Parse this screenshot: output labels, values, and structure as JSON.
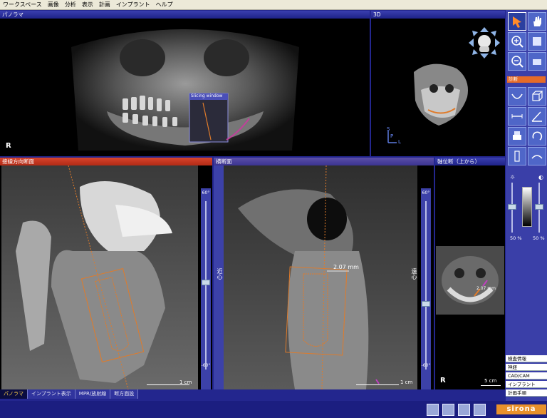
{
  "menu": [
    "ワークスペース",
    "画像",
    "分析",
    "表示",
    "計画",
    "インプラント",
    "ヘルプ"
  ],
  "panels": {
    "panorama": {
      "title": "パノラマ",
      "orientation": "R",
      "slicing_window_label": "Slicing window"
    },
    "view3d": {
      "title": "3D",
      "axis_s": "S",
      "axis_p": "P",
      "axis_l": "L"
    },
    "tangential": {
      "title": "接線方向断面",
      "scale": "1 cm",
      "top_deg": "60°",
      "bottom_deg": "-60°"
    },
    "cross": {
      "title": "横断面",
      "measurement": "2.07 mm",
      "scale": "1 cm",
      "left_label": "近心",
      "right_label": "遠心",
      "top_deg": "60°",
      "bottom_deg": "-60°"
    },
    "axial": {
      "title": "軸位断（上から）",
      "measurement": "2.07 mm",
      "scale": "5 cm",
      "orientation": "R"
    }
  },
  "tabs": [
    {
      "label": "パノラマ",
      "active": true
    },
    {
      "label": "インプラント表示",
      "active": false
    },
    {
      "label": "MPR/放射線",
      "active": false
    },
    {
      "label": "断方面設",
      "active": false
    }
  ],
  "toolbar": {
    "section_label": "診断",
    "pct_left": "50 %",
    "pct_right": "50 %",
    "bottom_buttons": [
      "検査情報",
      "神経",
      "CAD/CAM",
      "インプラント",
      "計画手順"
    ]
  },
  "brand": "sirona",
  "colors": {
    "accent_orange": "#e8912b",
    "panel_title_red": "#c0301b",
    "implant_outline": "#e07b2a"
  }
}
